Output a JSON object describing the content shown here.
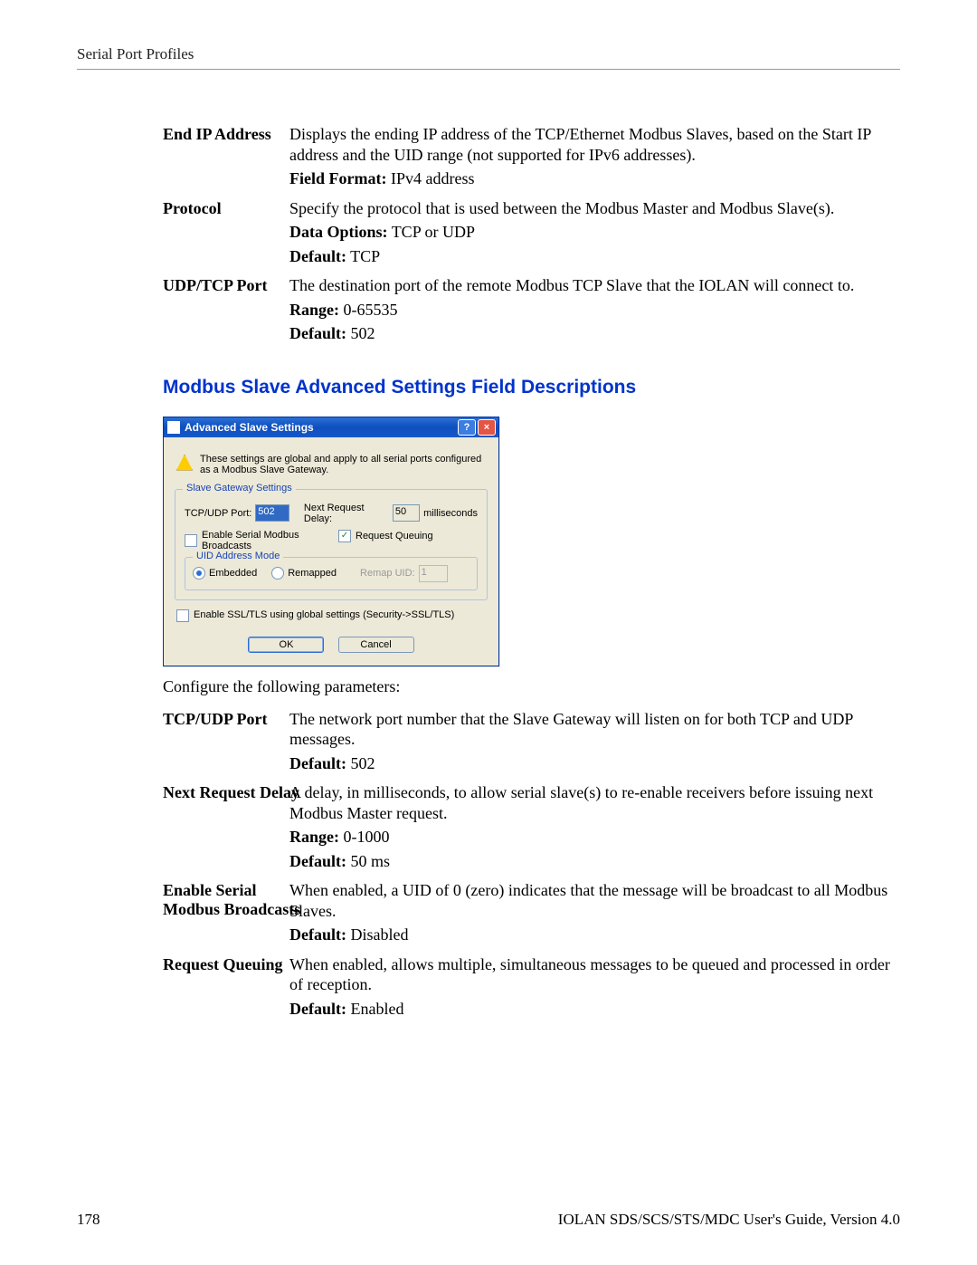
{
  "header": {
    "section_title": "Serial Port Profiles"
  },
  "fields_top": [
    {
      "label": "End IP Address",
      "desc": "Displays the ending IP address of the TCP/Ethernet Modbus Slaves, based on the Start IP address and the UID range (not supported for IPv6 addresses).",
      "meta": [
        {
          "bold": "Field Format:",
          "val": " IPv4 address"
        }
      ]
    },
    {
      "label": "Protocol",
      "desc": "Specify the protocol that is used between the Modbus Master and Modbus Slave(s).",
      "meta": [
        {
          "bold": "Data Options:",
          "val": " TCP or UDP"
        },
        {
          "bold": "Default:",
          "val": " TCP"
        }
      ]
    },
    {
      "label": "UDP/TCP Port",
      "desc": "The destination port of the remote Modbus TCP Slave that the IOLAN will connect to.",
      "meta": [
        {
          "bold": "Range:",
          "val": " 0-65535"
        },
        {
          "bold": "Default:",
          "val": " 502"
        }
      ]
    }
  ],
  "section_heading": "Modbus Slave Advanced Settings Field Descriptions",
  "dialog": {
    "title": "Advanced Slave Settings",
    "info": "These settings are global and apply to all serial ports configured as a Modbus Slave Gateway.",
    "group_legend": "Slave Gateway Settings",
    "tcp_udp_port_label": "TCP/UDP Port:",
    "tcp_udp_port_value": "502",
    "next_req_label": "Next Request Delay:",
    "next_req_value": "50",
    "next_req_unit": "milliseconds",
    "enable_broadcast_label": "Enable Serial Modbus Broadcasts",
    "request_queuing_label": "Request Queuing",
    "uid_legend": "UID Address Mode",
    "radio_embedded": "Embedded",
    "radio_remapped": "Remapped",
    "remap_uid_label": "Remap UID:",
    "remap_uid_value": "1",
    "ssl_label": "Enable SSL/TLS using global settings (Security->SSL/TLS)",
    "ok": "OK",
    "cancel": "Cancel"
  },
  "configure_line": "Configure the following parameters:",
  "fields_bottom": [
    {
      "label": "TCP/UDP Port",
      "desc": "The network port number that the Slave Gateway will listen on for both TCP and UDP messages.",
      "meta": [
        {
          "bold": "Default:",
          "val": " 502"
        }
      ]
    },
    {
      "label": "Next Request Delay",
      "desc": "A delay, in milliseconds, to allow serial slave(s) to re-enable receivers before issuing next Modbus Master request.",
      "meta": [
        {
          "bold": "Range:",
          "val": " 0-1000"
        },
        {
          "bold": "Default:",
          "val": " 50 ms"
        }
      ]
    },
    {
      "label": "Enable Serial Modbus Broadcasts",
      "desc": "When enabled, a UID of 0 (zero) indicates that the message will be broadcast to all Modbus Slaves.",
      "meta": [
        {
          "bold": "Default:",
          "val": " Disabled"
        }
      ]
    },
    {
      "label": "Request Queuing",
      "desc": "When enabled, allows multiple, simultaneous messages to be queued and processed in order of reception.",
      "meta": [
        {
          "bold": "Default:",
          "val": " Enabled"
        }
      ]
    }
  ],
  "footer": {
    "page_number": "178",
    "doc_title": "IOLAN SDS/SCS/STS/MDC User's Guide, Version 4.0"
  }
}
